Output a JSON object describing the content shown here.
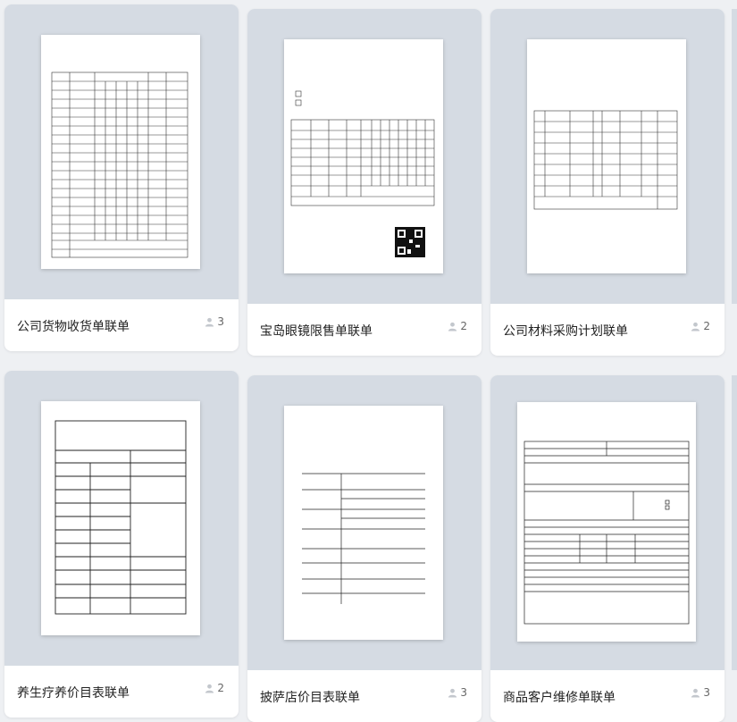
{
  "cards": [
    {
      "title": "公司货物收货单联单",
      "count": "3"
    },
    {
      "title": "宝岛眼镜限售单联单",
      "count": "2"
    },
    {
      "title": "公司材料采购计划联单",
      "count": "2"
    },
    {
      "title": "养生疗养价目表联单",
      "count": "2"
    },
    {
      "title": "披萨店价目表联单",
      "count": "3"
    },
    {
      "title": "商品客户维修单联单",
      "count": "3"
    }
  ]
}
